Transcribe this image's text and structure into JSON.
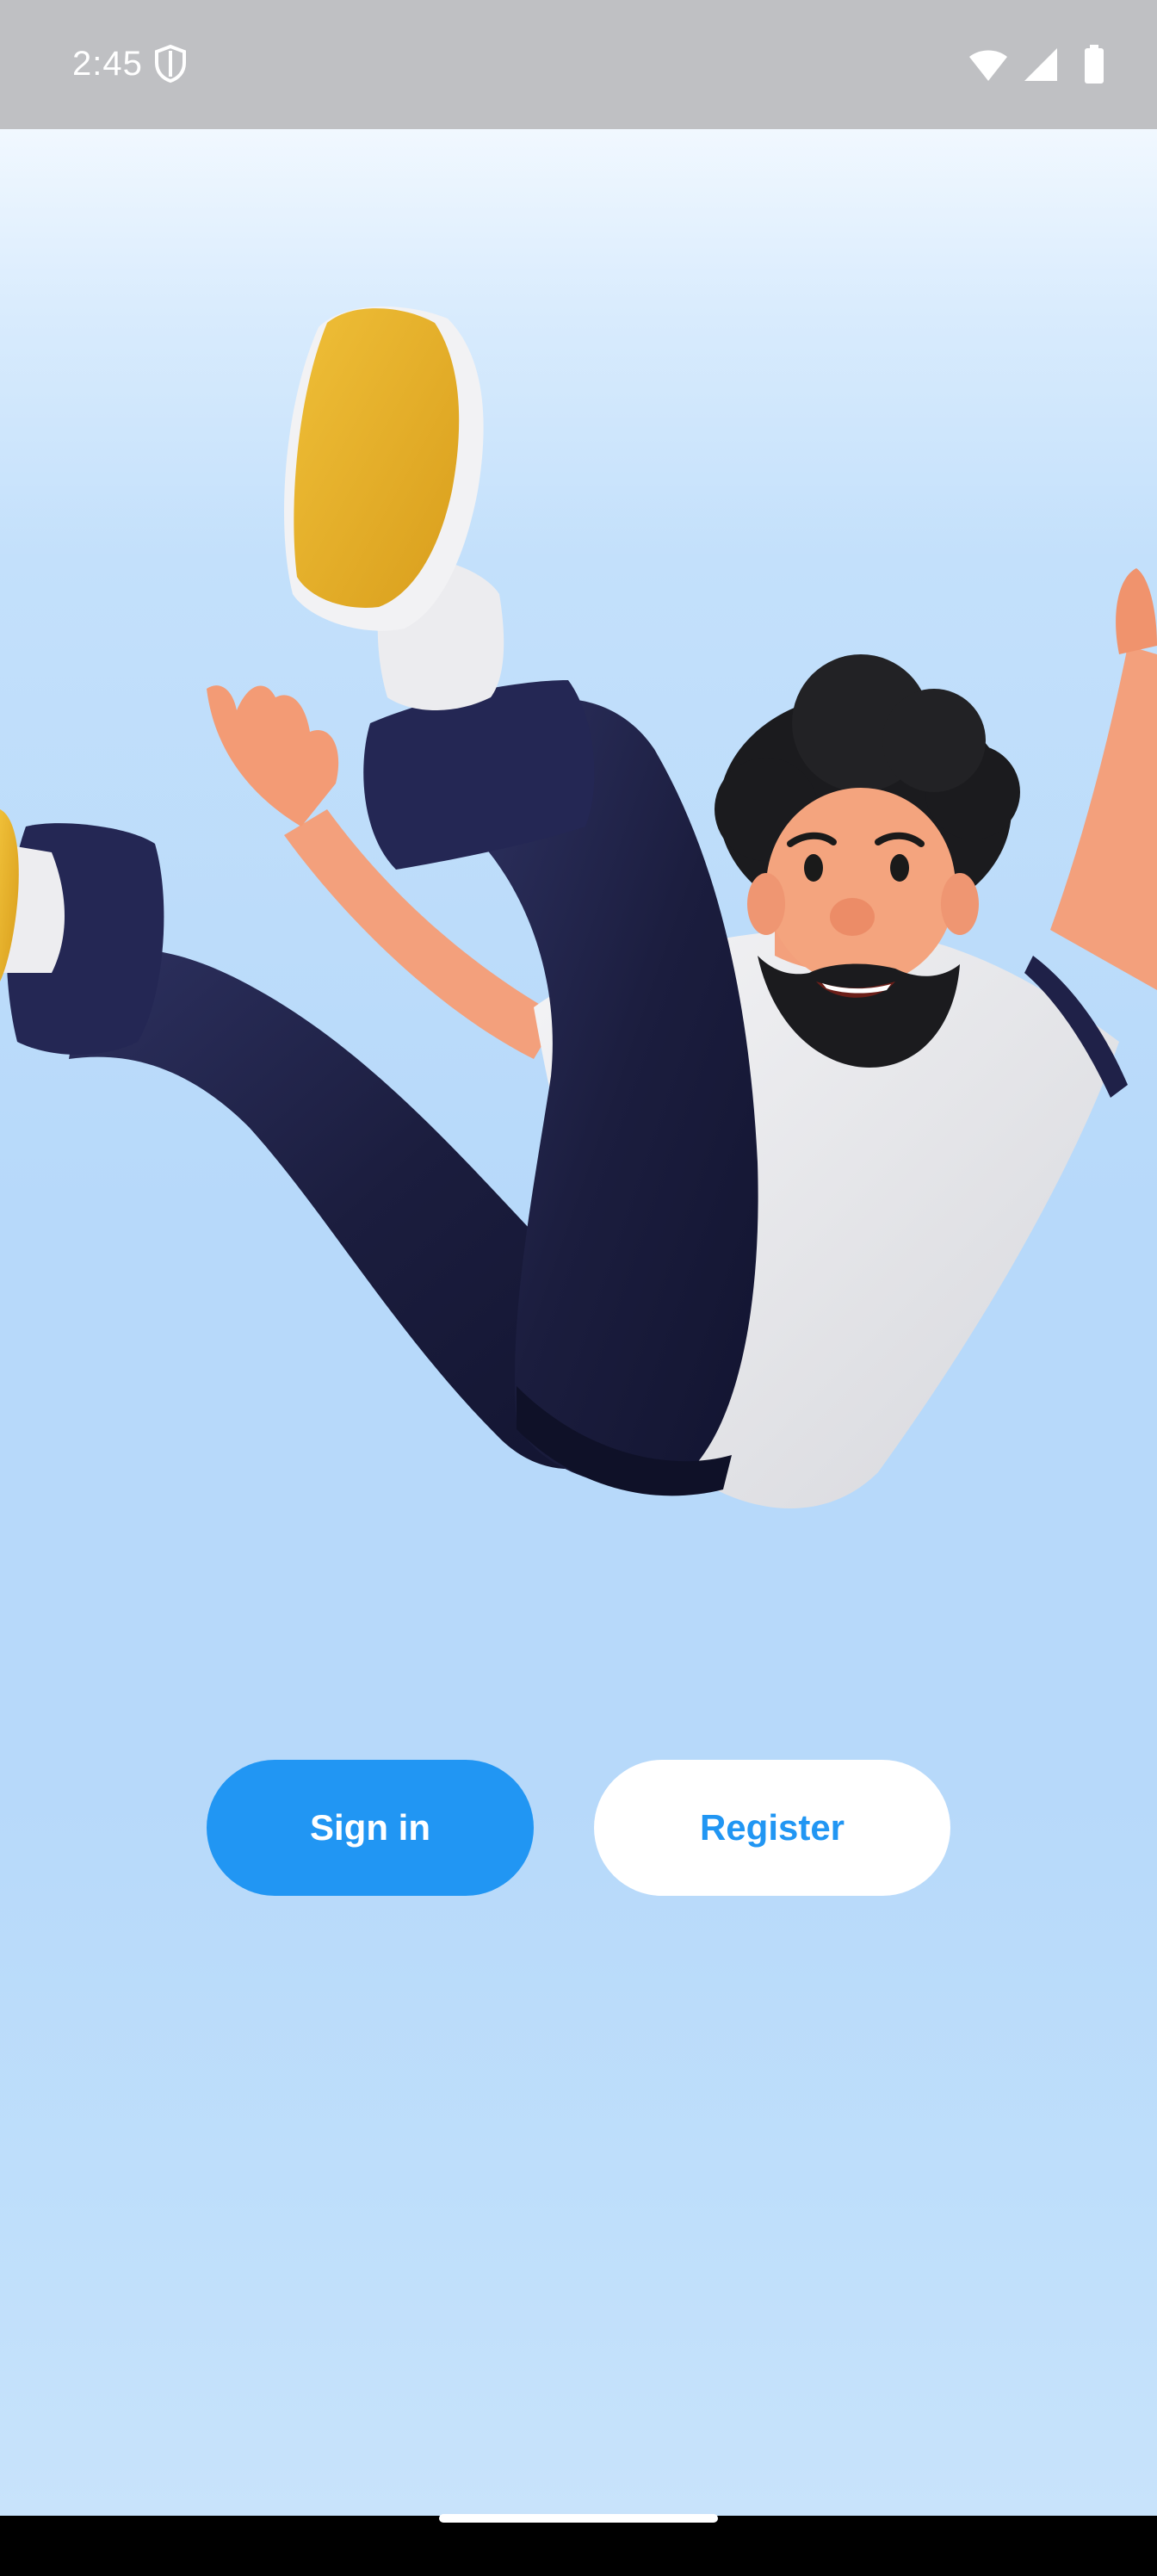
{
  "status_bar": {
    "time": "2:45",
    "icons": [
      "shield-icon",
      "wifi-icon",
      "cell-signal-icon",
      "battery-icon"
    ]
  },
  "hero": {
    "illustration": "falling-man-illustration"
  },
  "actions": {
    "sign_in_label": "Sign in",
    "register_label": "Register"
  },
  "colors": {
    "primary": "#2196f3",
    "background": "#b7d9fa",
    "status_bar": "#bfc0c3"
  }
}
